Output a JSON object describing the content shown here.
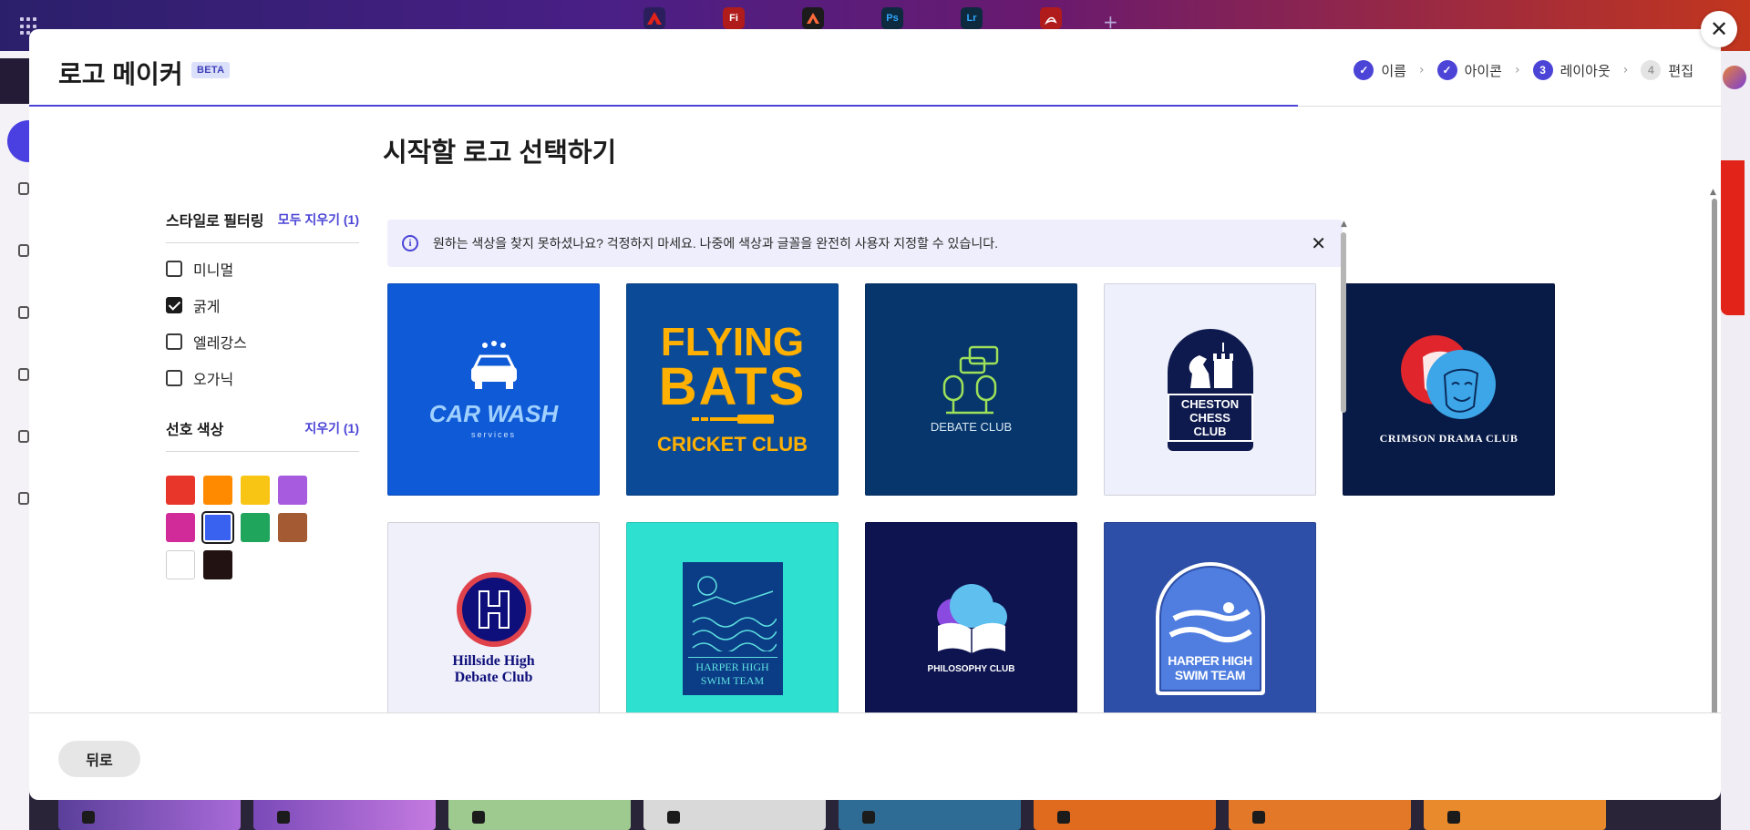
{
  "background": {
    "apps": [
      {
        "icon": "adobe-icon",
        "label": "",
        "bg": "#2a1f5c",
        "fg": "#e2231a"
      },
      {
        "icon": "fresco-icon",
        "label": "Fi",
        "bg": "#b01b1b",
        "fg": "#ffffff"
      },
      {
        "icon": "express-icon",
        "label": "",
        "bg": "#1b1b1b",
        "fg": "#ff6a3a"
      },
      {
        "icon": "photoshop-icon",
        "label": "Ps",
        "bg": "#0d2a3f",
        "fg": "#31a8ff"
      },
      {
        "icon": "lightroom-icon",
        "label": "Lr",
        "bg": "#0d2a3f",
        "fg": "#31a8ff"
      },
      {
        "icon": "acrobat-icon",
        "label": "",
        "bg": "#b01b1b",
        "fg": "#ffffff"
      }
    ]
  },
  "modal": {
    "title": "로고 메이커",
    "badge": "BETA",
    "close_label": "✕",
    "steps": [
      {
        "label": "이름",
        "state": "done",
        "mark": "✓"
      },
      {
        "label": "아이콘",
        "state": "done",
        "mark": "✓"
      },
      {
        "label": "레이아웃",
        "state": "current",
        "mark": "3"
      },
      {
        "label": "편집",
        "state": "pending",
        "mark": "4"
      }
    ],
    "page_title": "시작할 로고 선택하기",
    "filters": {
      "style_heading": "스타일로 필터링",
      "style_clear": "모두 지우기 (1)",
      "styles": [
        {
          "label": "미니멀",
          "checked": false
        },
        {
          "label": "굵게",
          "checked": true
        },
        {
          "label": "엘레강스",
          "checked": false
        },
        {
          "label": "오가닉",
          "checked": false
        }
      ],
      "color_heading": "선호 색상",
      "color_clear": "지우기 (1)",
      "colors": [
        {
          "name": "red",
          "hex": "#e8372a",
          "selected": false
        },
        {
          "name": "orange",
          "hex": "#ff8a00",
          "selected": false
        },
        {
          "name": "yellow",
          "hex": "#f9c514",
          "selected": false
        },
        {
          "name": "purple",
          "hex": "#a75ce0",
          "selected": false
        },
        {
          "name": "magenta",
          "hex": "#d12b9a",
          "selected": false
        },
        {
          "name": "blue",
          "hex": "#3a62f0",
          "selected": true
        },
        {
          "name": "green",
          "hex": "#1fa55c",
          "selected": false
        },
        {
          "name": "brown",
          "hex": "#a45a33",
          "selected": false
        },
        {
          "name": "white",
          "hex": "#ffffff",
          "selected": false
        },
        {
          "name": "black",
          "hex": "#221212",
          "selected": false
        }
      ]
    },
    "banner": {
      "text": "원하는 색상을 찾지 못하셨나요? 걱정하지 마세요. 나중에 색상과 글꼴을 완전히 사용자 지정할 수 있습니다.",
      "close": "✕"
    },
    "logos": [
      {
        "id": "car-wash",
        "bg": "#0f5ad6",
        "line1": "CAR WASH",
        "line2": "services"
      },
      {
        "id": "flying-bats",
        "bg": "#0b4a96",
        "line1": "FLYING",
        "line2": "BATS",
        "line3": "CRICKET CLUB"
      },
      {
        "id": "debate-club",
        "bg": "#06366b",
        "line1": "DEBATE CLUB"
      },
      {
        "id": "cheston-chess",
        "bg": "#eef0fb",
        "line1": "CHESTON",
        "line2": "CHESS CLUB"
      },
      {
        "id": "crimson-drama",
        "bg": "#081a46",
        "line1": "CRIMSON DRAMA CLUB"
      },
      {
        "id": "hillside-debate",
        "bg": "#f0f0fa",
        "line1": "Hillside High",
        "line2": "Debate Club"
      },
      {
        "id": "harper-swim-1",
        "bg": "#2ee0d0",
        "line1": "HARPER HIGH",
        "line2": "SWIM TEAM"
      },
      {
        "id": "philosophy-club",
        "bg": "#0d1450",
        "line1": "PHILOSOPHY CLUB"
      },
      {
        "id": "harper-swim-2",
        "bg": "#2e4fa8",
        "line1": "HARPER HIGH",
        "line2": "SWIM TEAM"
      }
    ],
    "back_label": "뒤로"
  }
}
